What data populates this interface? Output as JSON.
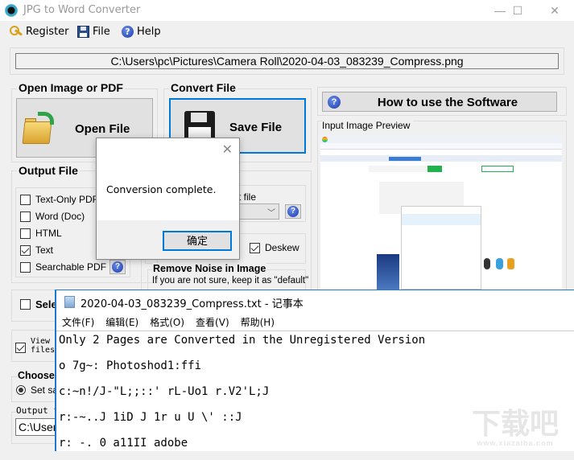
{
  "window": {
    "title": "JPG to Word Converter",
    "controls": {
      "minimize": "—",
      "maximize": "☐",
      "close": "✕"
    }
  },
  "menu": {
    "items": [
      {
        "label": "Register",
        "icon": "key-icon"
      },
      {
        "label": "File",
        "icon": "floppy-disk-icon"
      },
      {
        "label": "Help",
        "icon": "help-icon"
      }
    ]
  },
  "path": {
    "value": "C:\\Users\\pc\\Pictures\\Camera Roll\\2020-04-03_083239_Compress.png"
  },
  "open_group": {
    "title": "Open Image or PDF",
    "button_label": "Open File"
  },
  "convert_group": {
    "title": "Convert File",
    "button_label": "Save File"
  },
  "how_to": {
    "label": "How to use the Software",
    "help_glyph": "?"
  },
  "preview": {
    "label": "Input Image Preview"
  },
  "output_group": {
    "title": "Output File",
    "options": [
      {
        "label": "Text-Only PDF",
        "checked": false
      },
      {
        "label": "Word (Doc)",
        "checked": false
      },
      {
        "label": "HTML",
        "checked": false
      },
      {
        "label": "Text",
        "checked": true
      },
      {
        "label": "Searchable PDF",
        "checked": false
      }
    ]
  },
  "options_panel": {
    "partial_label": "t file",
    "deskew": {
      "label": "Deskew",
      "checked": true
    },
    "noise": {
      "title": "Remove Noise in Image",
      "hint": "If you are not sure, keep it as \"default\""
    }
  },
  "left_lower": {
    "select_label": "Sele",
    "view_files_line1": "View",
    "view_files_line2": "files",
    "view_files_checked": true,
    "choose_title": "Choose",
    "set_same_label": "Set sa",
    "output_folder_label": "Output f",
    "output_folder_value": "C:\\User"
  },
  "dialog": {
    "message": "Conversion complete.",
    "ok_label": "确定",
    "close_glyph": "✕"
  },
  "notepad": {
    "title": "2020-04-03_083239_Compress.txt - 记事本",
    "menu": [
      "文件(F)",
      "编辑(E)",
      "格式(O)",
      "查看(V)",
      "帮助(H)"
    ],
    "lines": [
      "Only 2 Pages are Converted in the Unregistered Version",
      "o 7g~: Photoshod1:ffi",
      "c:~n!/J-\"L;;::' rL-Uo1 r.V2'L;J",
      "r:-~..J 1iD J 1r u U \\' ::J",
      "r: -. 0 a11II adobe"
    ]
  },
  "watermark": {
    "text": "下载吧",
    "sub": "www.xiazaiba.com"
  }
}
